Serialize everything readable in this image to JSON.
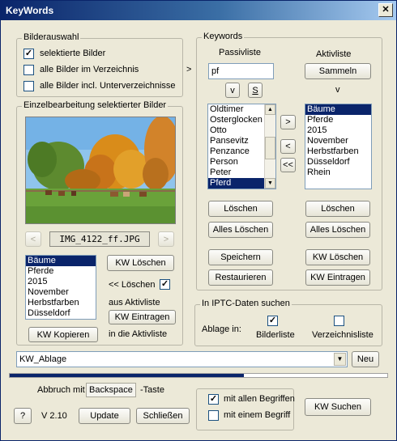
{
  "window": {
    "title": "KeyWords",
    "close_label": "✕"
  },
  "bilderauswahl": {
    "legend": "Bilderauswahl",
    "options": [
      {
        "label": "selektierte Bilder",
        "checked": true
      },
      {
        "label": "alle Bilder im Verzeichnis",
        "checked": false
      },
      {
        "label": "alle Bilder incl. Unterverzeichnisse",
        "checked": false
      }
    ],
    "arrow": ">"
  },
  "einzel": {
    "legend": "Einzelbearbeitung selektierter Bilder",
    "prev_label": "<",
    "next_label": ">",
    "filename": "IMG_4122_ff.JPG",
    "keywords": [
      "Bäume",
      "Pferde",
      "2015",
      "November",
      "Herbstfarben",
      "Düsseldorf"
    ],
    "selected_index": 0,
    "kw_loeschen": "KW Löschen",
    "loeschen_label": "<< Löschen",
    "loeschen_checked": true,
    "aus_aktivliste": "aus Aktivliste",
    "kw_eintragen": "KW Eintragen",
    "kw_kopieren": "KW Kopieren",
    "in_die_aktivliste": "in die Aktivliste"
  },
  "keywords": {
    "legend": "Keywords",
    "passiv_title": "Passivliste",
    "aktiv_title": "Aktivliste",
    "search_value": "pf",
    "v_label": "v",
    "s_label": "S",
    "sammeln": "Sammeln",
    "aktiv_v": "v",
    "passiv_items": [
      "Oldtimer",
      "Osterglocken",
      "Otto",
      "Pansevitz",
      "Penzance",
      "Person",
      "Peter",
      "Pferd"
    ],
    "passiv_selected": 7,
    "aktiv_items": [
      "Bäume",
      "Pferde",
      "2015",
      "November",
      "Herbstfarben",
      "Düsseldorf",
      "Rhein"
    ],
    "aktiv_selected": 0,
    "move_right": ">",
    "move_left": "<",
    "move_all_left": "<<",
    "loeschen": "Löschen",
    "alles_loeschen": "Alles Löschen",
    "speichern": "Speichern",
    "restaurieren": "Restaurieren",
    "kw_loeschen": "KW Löschen",
    "kw_eintragen": "KW Eintragen"
  },
  "iptc": {
    "legend": "In IPTC-Daten suchen",
    "ablage_in": "Ablage in:",
    "bilderliste": "Bilderliste",
    "bilderliste_checked": true,
    "verzeichnisliste": "Verzeichnisliste",
    "verzeichnisliste_checked": false
  },
  "ablage": {
    "value": "KW_Ablage",
    "neu": "Neu"
  },
  "progress": {
    "value": 0.62
  },
  "abbruch": {
    "prefix": "Abbruch mit",
    "key": "Backspace",
    "suffix": "-Taste"
  },
  "footer": {
    "help": "?",
    "version": "V 2.10",
    "update": "Update",
    "schliessen": "Schließen",
    "mit_allen": "mit allen Begriffen",
    "mit_allen_checked": true,
    "mit_einem": "mit einem Begriff",
    "mit_einem_checked": false,
    "kw_suchen": "KW Suchen"
  },
  "colors": {
    "accent": "#0a246a",
    "window_bg": "#ece9d8"
  }
}
